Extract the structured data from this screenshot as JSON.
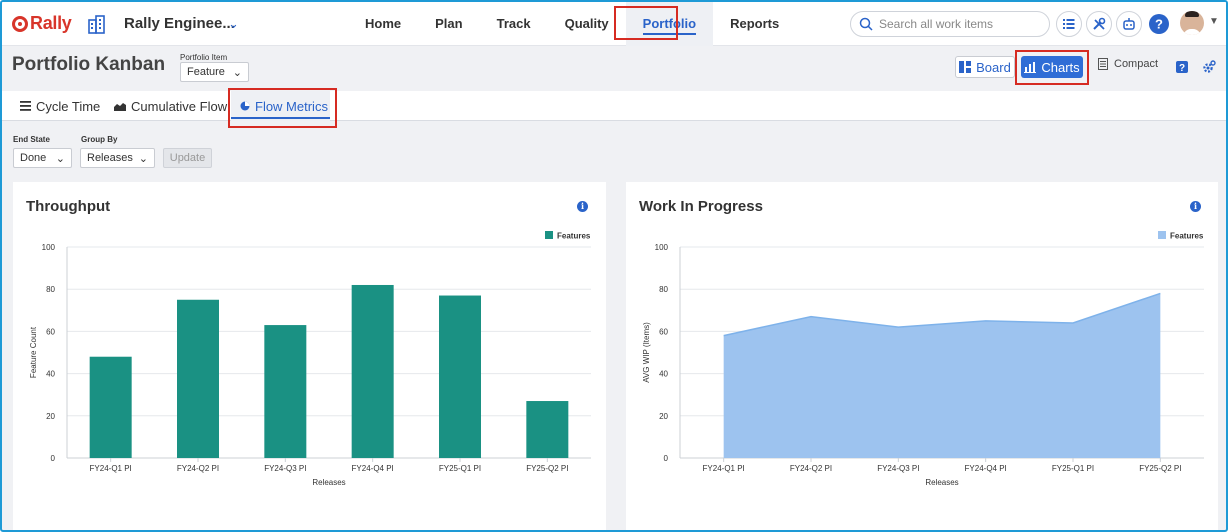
{
  "topnav": {
    "logo": "Rally",
    "workspace": "Rally Enginee...",
    "links": [
      {
        "label": "Home"
      },
      {
        "label": "Plan"
      },
      {
        "label": "Track"
      },
      {
        "label": "Quality"
      },
      {
        "label": "Portfolio",
        "active": true
      },
      {
        "label": "Reports"
      }
    ],
    "search_placeholder": "Search all work items"
  },
  "header": {
    "title": "Portfolio Kanban",
    "portfolio_item_label": "Portfolio Item",
    "portfolio_item_value": "Feature",
    "board_label": "Board",
    "charts_label": "Charts",
    "compact_label": "Compact"
  },
  "tabs": [
    {
      "label": "Cycle Time",
      "icon": "list-icon"
    },
    {
      "label": "Cumulative Flow",
      "icon": "area-chart-icon"
    },
    {
      "label": "Flow Metrics",
      "icon": "pie-chart-icon",
      "active": true
    }
  ],
  "filters": {
    "end_state_label": "End State",
    "end_state_value": "Done",
    "group_by_label": "Group By",
    "group_by_value": "Releases",
    "update_label": "Update"
  },
  "colors": {
    "accent": "#2f6dd6",
    "throughput_bar": "#1a9183",
    "wip_fill": "#9dc3ef",
    "wip_line": "#7eb2ea",
    "highlight": "#d62b22"
  },
  "chart_data": [
    {
      "type": "bar",
      "title": "Throughput",
      "categories": [
        "FY24-Q1 PI",
        "FY24-Q2 PI",
        "FY24-Q3 PI",
        "FY24-Q4 PI",
        "FY25-Q1 PI",
        "FY25-Q2 PI"
      ],
      "series": [
        {
          "name": "Features",
          "values": [
            48,
            75,
            63,
            82,
            77,
            27
          ]
        }
      ],
      "xlabel": "Releases",
      "ylabel": "Feature Count",
      "ylim": [
        0,
        100
      ],
      "yticks": [
        0,
        20,
        40,
        60,
        80,
        100
      ],
      "grid": true,
      "legend": "top-right"
    },
    {
      "type": "area",
      "title": "Work In Progress",
      "categories": [
        "FY24-Q1 PI",
        "FY24-Q2 PI",
        "FY24-Q3 PI",
        "FY24-Q4 PI",
        "FY25-Q1 PI",
        "FY25-Q2 PI"
      ],
      "series": [
        {
          "name": "Features",
          "values": [
            58,
            67,
            62,
            65,
            64,
            78
          ]
        }
      ],
      "xlabel": "Releases",
      "ylabel": "AVG WIP (Items)",
      "ylim": [
        0,
        100
      ],
      "yticks": [
        0,
        20,
        40,
        60,
        80,
        100
      ],
      "grid": true,
      "legend": "top-right"
    }
  ]
}
